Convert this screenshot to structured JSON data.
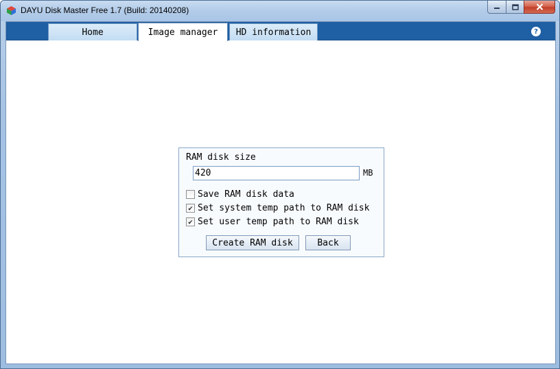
{
  "window": {
    "title": "DAYU Disk Master Free 1.7  (Build: 20140208)"
  },
  "tabs": [
    {
      "label": "Home",
      "active": false
    },
    {
      "label": "Image manager",
      "active": true
    },
    {
      "label": "HD information",
      "active": false
    }
  ],
  "help": {
    "label": "?"
  },
  "ram_disk": {
    "size_label": "RAM disk size",
    "size_value": "420",
    "unit": "MB",
    "options": [
      {
        "label": "Save RAM disk data",
        "checked": false
      },
      {
        "label": "Set system temp path to RAM disk",
        "checked": true
      },
      {
        "label": "Set user temp path to RAM disk",
        "checked": true
      }
    ],
    "create_label": "Create RAM disk",
    "back_label": "Back"
  },
  "colors": {
    "tab_bar": "#1f5fa3",
    "title_bar": "#b2cbe8",
    "close_button": "#c2402a"
  }
}
